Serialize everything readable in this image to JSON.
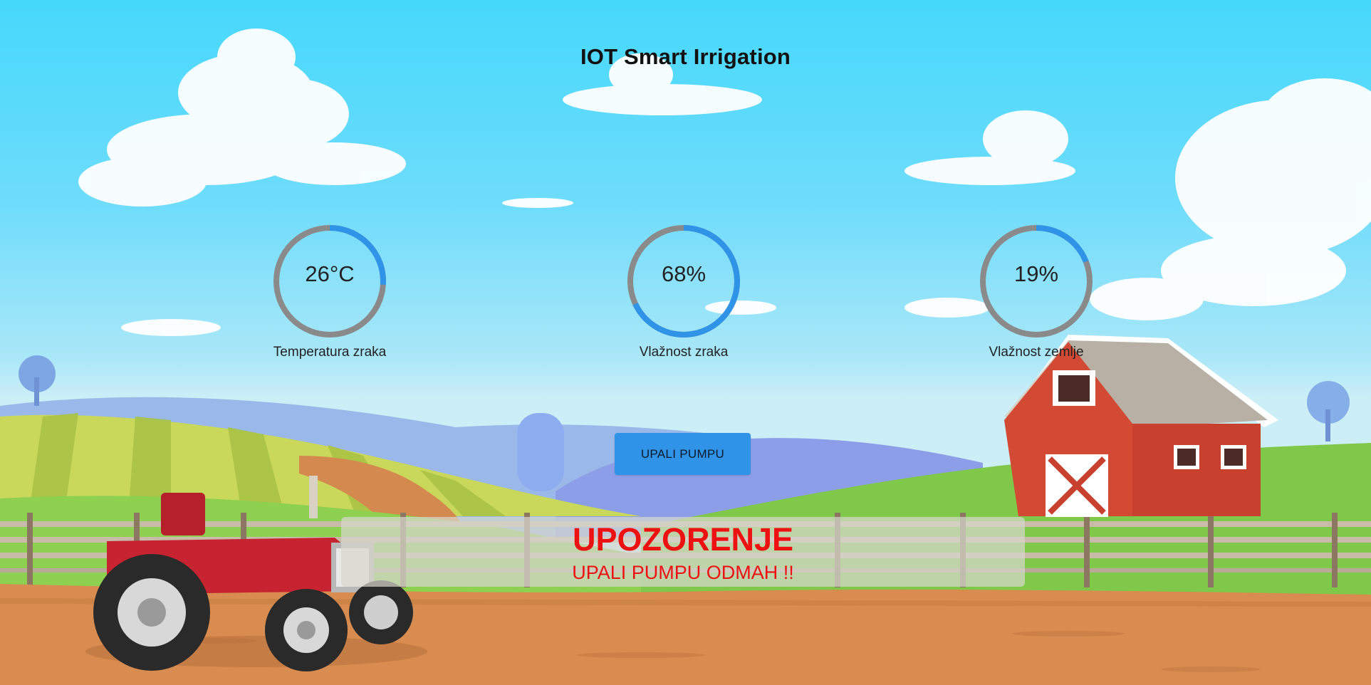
{
  "app": {
    "title": "IOT Smart Irrigation"
  },
  "gauges": [
    {
      "id": "temperature",
      "value_text": "26°C",
      "label": "Temperatura zraka",
      "fraction": 0.26
    },
    {
      "id": "air-humidity",
      "value_text": "68%",
      "label": "Vlažnost zraka",
      "fraction": 0.68
    },
    {
      "id": "soil-humidity",
      "value_text": "19%",
      "label": "Vlažnost zemlje",
      "fraction": 0.19
    }
  ],
  "pump": {
    "button_label": "UPALI PUMPU"
  },
  "warning": {
    "title": "UPOZORENJE",
    "message": "UPALI PUMPU ODMAH !!"
  },
  "colors": {
    "gauge_track": "#8a8a8a",
    "gauge_progress": "#2f94e8",
    "button_bg": "#2f94e8",
    "warning_text": "#ee1111"
  },
  "icons": {
    "scene": "farm-illustration",
    "tractor": "tractor-icon",
    "barn": "barn-icon"
  }
}
